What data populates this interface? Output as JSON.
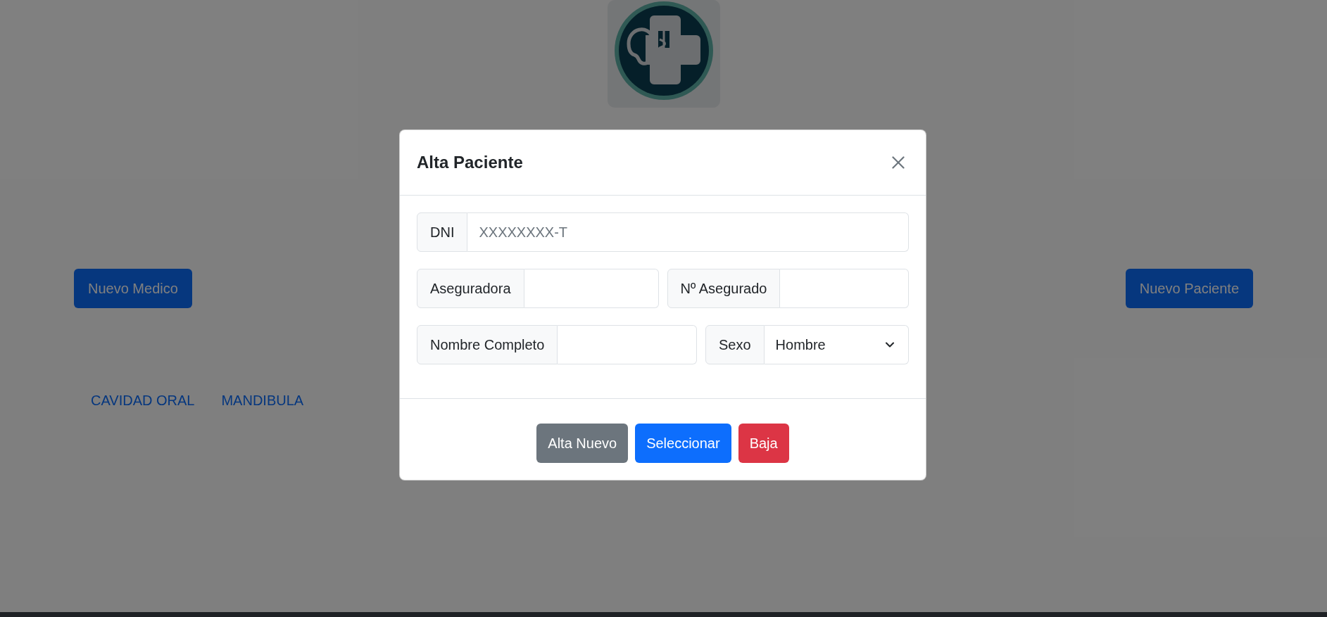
{
  "actions": [
    {
      "label": "Nuevo Medico"
    },
    {
      "label": "Nuevo Paciente"
    }
  ],
  "nav_links": [
    "CAVIDAD ORAL",
    "MANDIBULA"
  ],
  "modal": {
    "title": "Alta Paciente",
    "rows": [
      [
        {
          "kind": "input",
          "label": "DNI",
          "placeholder": "XXXXXXXX-T"
        }
      ],
      [
        {
          "kind": "input",
          "label": "Aseguradora"
        },
        {
          "kind": "input",
          "label": "Nº Asegurado"
        }
      ],
      [
        {
          "kind": "input",
          "label": "Nombre Completo"
        },
        {
          "kind": "select",
          "label": "Sexo",
          "value": "Hombre"
        }
      ]
    ],
    "buttons": [
      {
        "label": "Alta Nuevo",
        "kind": "secondary"
      },
      {
        "label": "Seleccionar",
        "kind": "primary"
      },
      {
        "label": "Baja",
        "kind": "danger"
      }
    ]
  }
}
